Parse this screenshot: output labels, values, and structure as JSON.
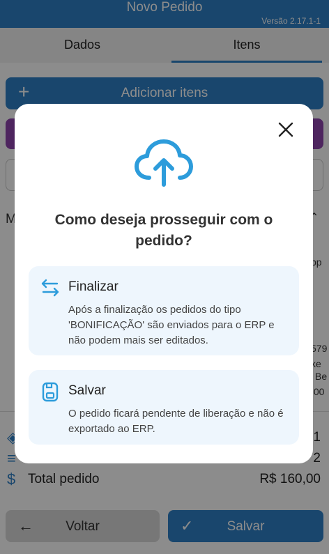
{
  "header": {
    "title": "Novo Pedido",
    "version": "Versão 2.17.1-1"
  },
  "tabs": [
    {
      "label": "Dados",
      "active": false
    },
    {
      "label": "Itens",
      "active": true
    }
  ],
  "actions": {
    "add_items_label": "Adicionar itens"
  },
  "fragments": {
    "section_letter": "M",
    "pp": "pp",
    "n579": "579",
    "ke": "ke",
    "be": "Be",
    "zero": ",00"
  },
  "summary": {
    "row1_value": "1",
    "row2_value": "2",
    "total_label": "Total pedido",
    "total_value": "R$ 160,00"
  },
  "footer": {
    "back_label": "Voltar",
    "save_label": "Salvar"
  },
  "modal": {
    "title": "Como deseja prosseguir com o pedido?",
    "options": [
      {
        "icon": "swap-arrows-icon",
        "title": "Finalizar",
        "description": "Após a finalização os pedidos do tipo 'BONIFICAÇÃO' são enviados para o ERP e não podem mais ser editados."
      },
      {
        "icon": "save-disk-icon",
        "title": "Salvar",
        "description": "O pedido ficará pendente de liberação e não é exportado ao ERP."
      }
    ]
  },
  "colors": {
    "primary": "#2f80c6",
    "icon_blue": "#2d9cdb",
    "purple": "#8e44ad",
    "option_bg": "#eef6fd"
  }
}
